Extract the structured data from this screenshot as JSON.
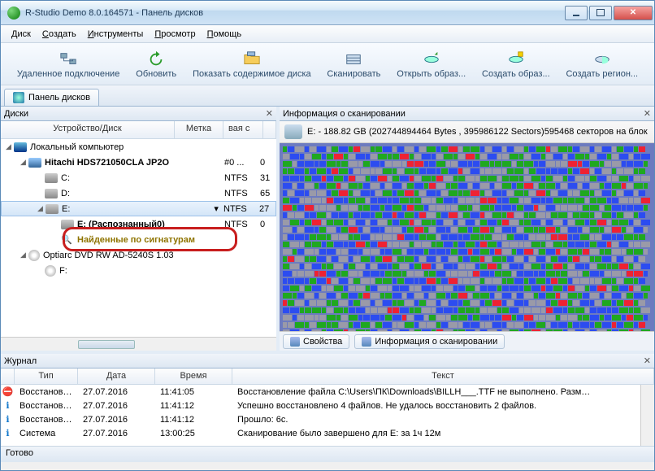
{
  "title": "R-Studio Demo 8.0.164571 - Панель дисков",
  "menu": {
    "disk": "Диск",
    "create": "Создать",
    "tools": "Инструменты",
    "view": "Просмотр",
    "help": "Помощь"
  },
  "toolbar": {
    "remote": "Удаленное подключение",
    "refresh": "Обновить",
    "showcontent": "Показать содержимое диска",
    "scan": "Сканировать",
    "openimage": "Открыть образ...",
    "createimage": "Создать образ...",
    "createregion": "Создать регион..."
  },
  "tabs": {
    "diskpanel": "Панель дисков"
  },
  "left": {
    "title": "Диски",
    "hdr": {
      "dev": "Устройство/Диск",
      "label": "Метка",
      "fs": "вая с"
    },
    "rows": [
      {
        "name": "Локальный компьютер",
        "fs": "",
        "start": ""
      },
      {
        "name": "Hitachi HDS721050CLA JP2O",
        "fs": "#0 ...",
        "start": "0"
      },
      {
        "name": "C:",
        "fs": "NTFS",
        "start": "31"
      },
      {
        "name": "D:",
        "fs": "NTFS",
        "start": "65"
      },
      {
        "name": "E:",
        "fs": "NTFS",
        "start": "27"
      },
      {
        "name": "E: (Распознанный0)",
        "fs": "NTFS",
        "start": "0"
      },
      {
        "name": "Найденные по сигнатурам",
        "fs": "",
        "start": ""
      },
      {
        "name": "Optiarc DVD RW AD-5240S 1.03",
        "fs": "",
        "start": ""
      },
      {
        "name": "F:",
        "fs": "",
        "start": ""
      }
    ]
  },
  "right": {
    "title": "Информация о сканировании",
    "diskinfo": "E: - 188.82 GB (202744894464 Bytes , 395986122 Sectors)595468 секторов на блок",
    "tabs": {
      "props": "Свойства",
      "scaninfo": "Информация о сканировании"
    }
  },
  "journal": {
    "title": "Журнал",
    "hdr": {
      "type": "Тип",
      "date": "Дата",
      "time": "Время",
      "text": "Текст"
    },
    "rows": [
      {
        "ico": "err",
        "type": "Восстанов…",
        "date": "27.07.2016",
        "time": "11:41:05",
        "text": "Восстановление файла C:\\Users\\ПК\\Downloads\\BILLH___.TTF не выполнено. Разм…"
      },
      {
        "ico": "inf",
        "type": "Восстанов…",
        "date": "27.07.2016",
        "time": "11:41:12",
        "text": "Успешно восстановлено 4 файлов. Не удалось восстановить 2 файлов."
      },
      {
        "ico": "inf",
        "type": "Восстанов…",
        "date": "27.07.2016",
        "time": "11:41:12",
        "text": "Прошло: 6с."
      },
      {
        "ico": "inf",
        "type": "Система",
        "date": "27.07.2016",
        "time": "13:00:25",
        "text": "Сканирование было завершено для E: за 1ч 12м"
      }
    ]
  },
  "status": "Готово"
}
